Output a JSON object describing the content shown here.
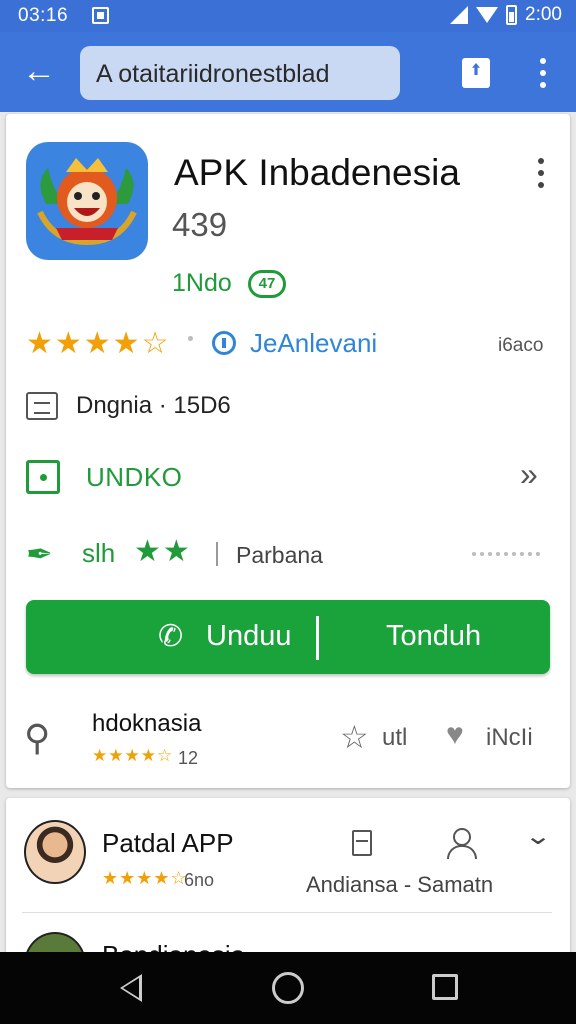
{
  "status_bar": {
    "time": "03:16",
    "right_text": "2:00"
  },
  "app_bar": {
    "search_text": "A  otaitariidronestblad"
  },
  "app": {
    "title": "APK Inbadenesia",
    "version": "439",
    "tag": "1Ndo",
    "tag_badge": "47",
    "rating_stars": "★★★★☆",
    "developer": "JeAnlevani",
    "downloads": "i6aco",
    "size_info": "Dngnia · 15D6",
    "download_label": "UNDKO",
    "rate_label": "slh",
    "rate_stars": "★★",
    "rate_note": "Parbana",
    "cta_left": "Unduu",
    "cta_right": "Tonduh",
    "review_title": "hdoknasia",
    "review_stars": "★★★★☆",
    "review_count": "12",
    "action_one": "utl",
    "action_two": "iNcIi"
  },
  "list": {
    "item1": {
      "title": "Patdal APP",
      "stars": "★★★★☆",
      "count": "6no",
      "meta": "Andiansa - Samatn"
    },
    "item2": {
      "title": "Bandianesia"
    }
  },
  "icons": {
    "status": [
      "notification-icon",
      "signal-icon",
      "wifi-icon",
      "battery-icon"
    ],
    "app_bar": [
      "back-arrow-icon",
      "share-icon",
      "overflow-menu-icon"
    ],
    "nav": [
      "nav-back-icon",
      "nav-home-icon",
      "nav-recents-icon"
    ]
  },
  "colors": {
    "app_bar": "#3e75db",
    "accent_green": "#1aa23b",
    "star": "#f2a007",
    "link_blue": "#2f86d8"
  }
}
